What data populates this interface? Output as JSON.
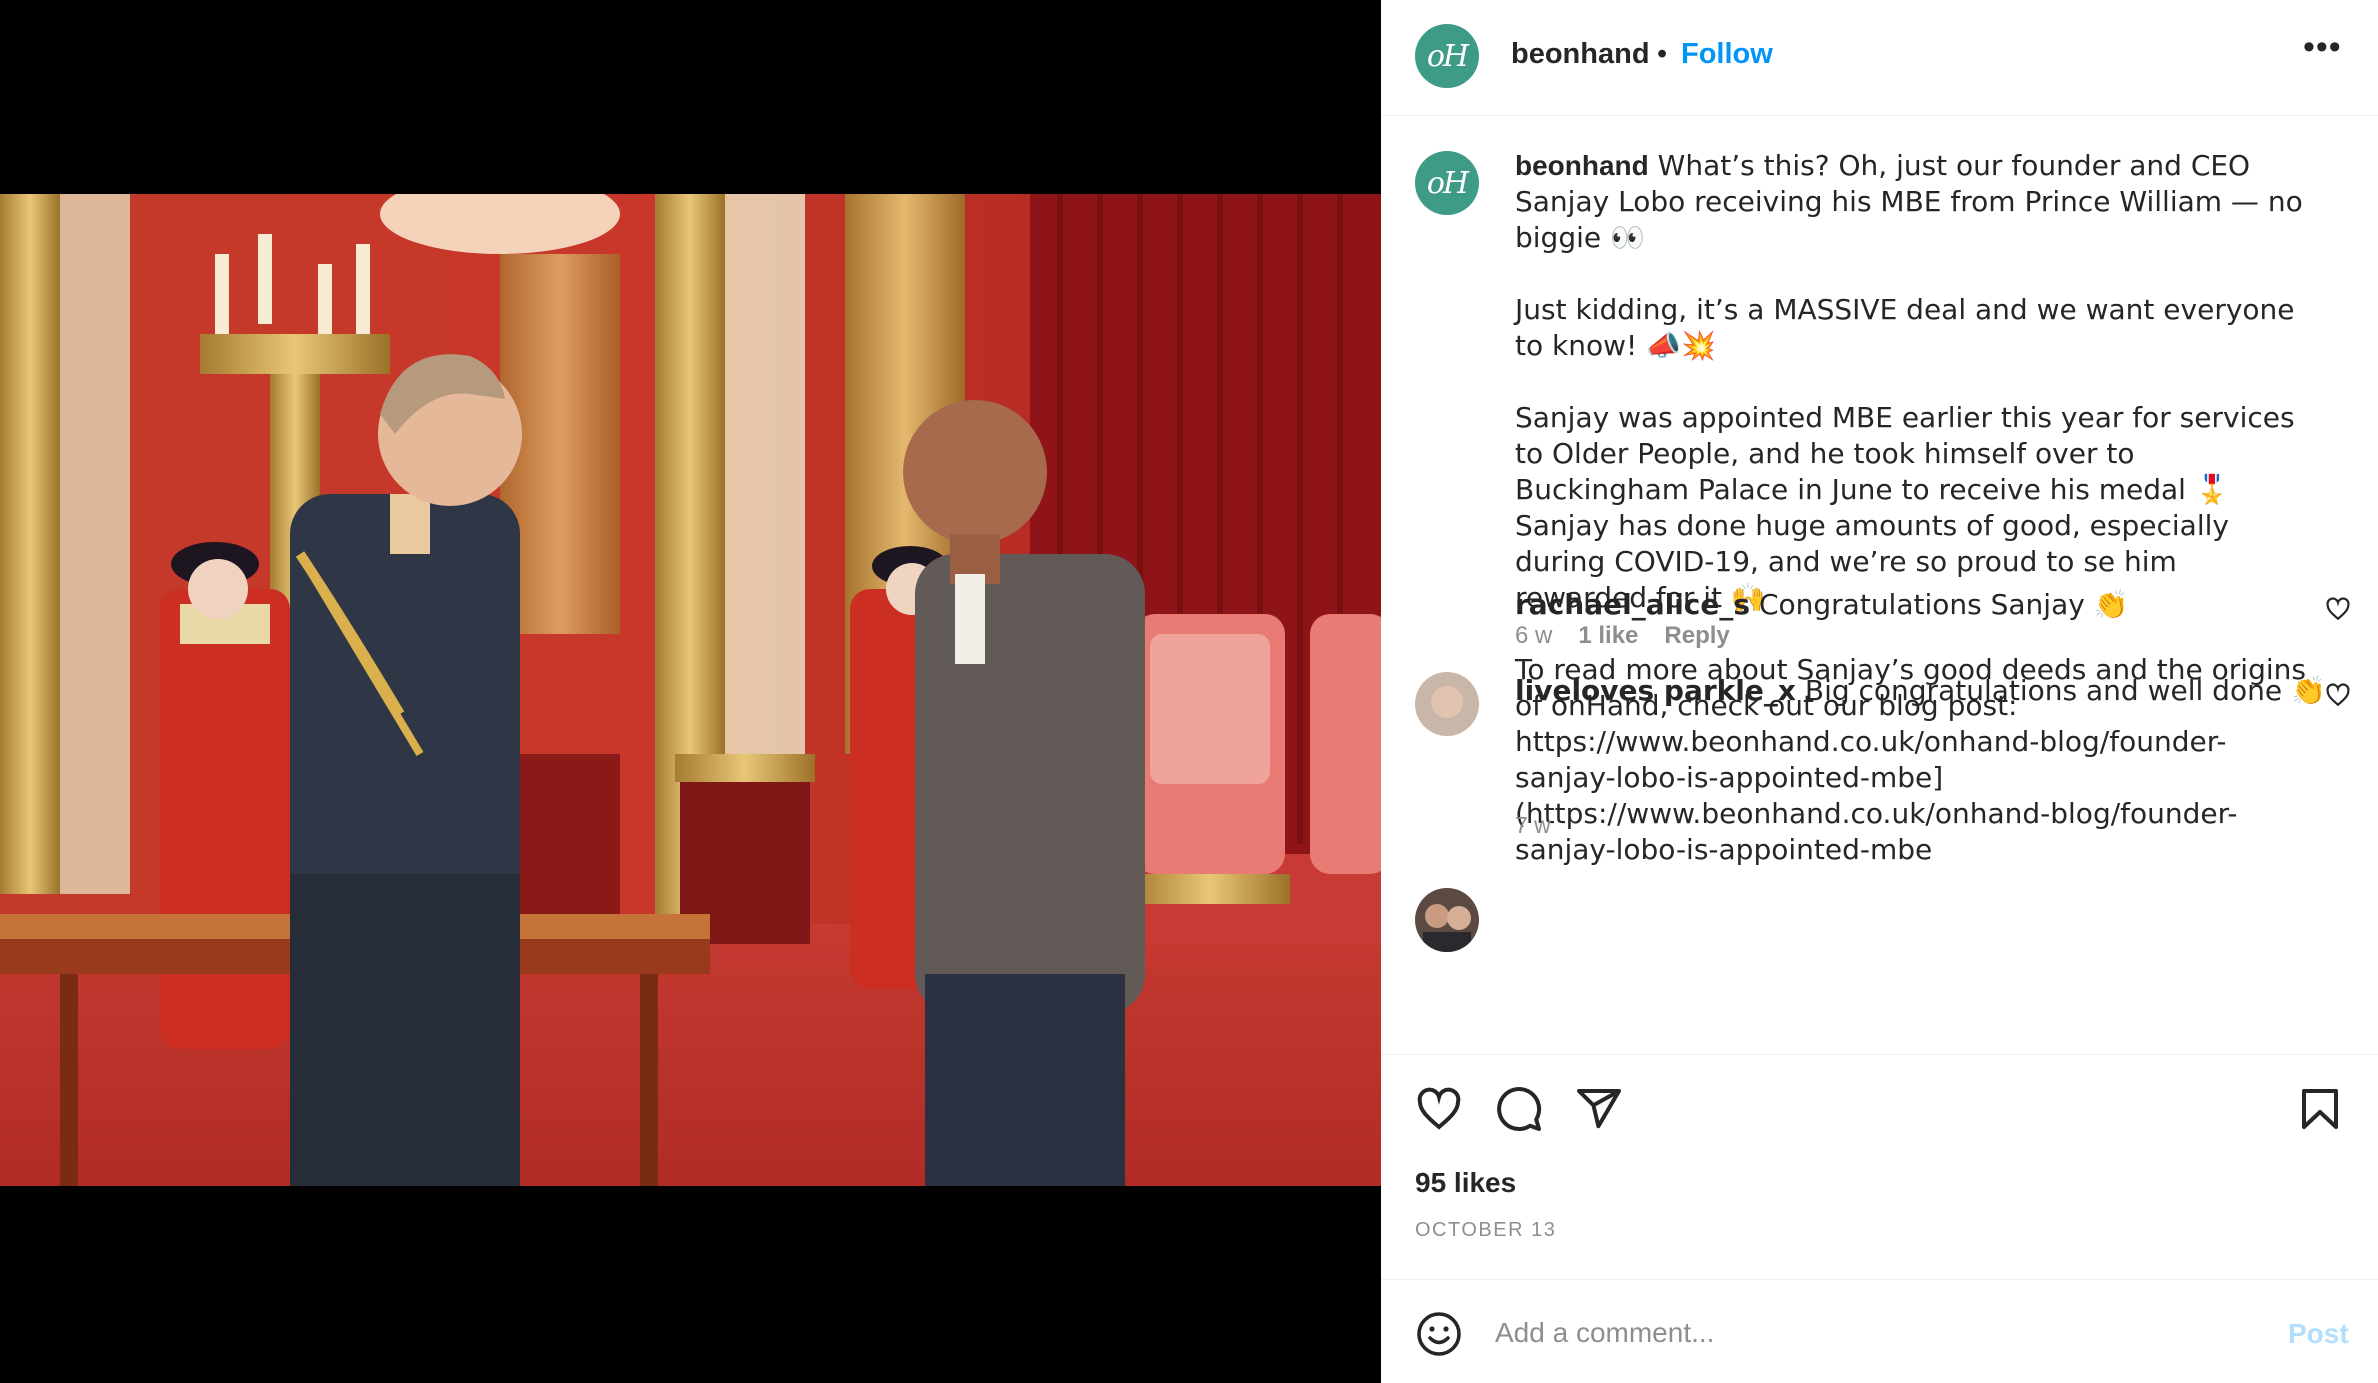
{
  "colors": {
    "accent": "#0095f6",
    "avatar_bg": "#3e9b86",
    "muted": "#8e8e8e",
    "post_disabled": "#b2dffc"
  },
  "post": {
    "image_alt": "Prince William presenting an MBE to Sanjay Lobo at Buckingham Palace"
  },
  "header": {
    "avatar_text": "oH",
    "username": "beonhand",
    "separator": "•",
    "follow_label": "Follow",
    "more_icon": "more-horizontal-icon"
  },
  "caption": {
    "avatar_text": "oH",
    "username": "beonhand",
    "text": " What’s this? Oh, just our founder and CEO Sanjay Lobo receiving his MBE from Prince William — no biggie 👀\n\nJust kidding, it’s a MASSIVE deal and we want everyone to know! 📣💥\n\nSanjay was appointed MBE earlier this year for services to Older People, and he took himself over to Buckingham Palace in June to receive his medal 🎖️ Sanjay has done huge amounts of good, especially during COVID-19, and we’re so proud to se him rewarded for it 🙌\n\nTo read more about Sanjay’s good deeds and the origins of onHand, check out our blog post: https://www.beonhand.co.uk/onhand-blog/founder-sanjay-lobo-is-appointed-mbe] (https://www.beonhand.co.uk/onhand-blog/founder-sanjay-lobo-is-appointed-mbe",
    "time": "7 w"
  },
  "comments": [
    {
      "username": "rachael_alice_s",
      "text": " Congratulations Sanjay 👏",
      "time": "6 w",
      "likes": "1 like",
      "reply": "Reply"
    },
    {
      "username": "liveloves parkle_x",
      "text": " Big congratulations and well done 👏",
      "time": "",
      "likes": "",
      "reply": ""
    }
  ],
  "actions": {
    "like_icon": "heart-icon",
    "comment_icon": "comment-icon",
    "share_icon": "paper-plane-icon",
    "save_icon": "bookmark-icon",
    "likes": "95 likes",
    "date": "OCTOBER 13"
  },
  "add_comment": {
    "placeholder": "Add a comment...",
    "post_label": "Post",
    "emoji_icon": "smiley-icon"
  }
}
